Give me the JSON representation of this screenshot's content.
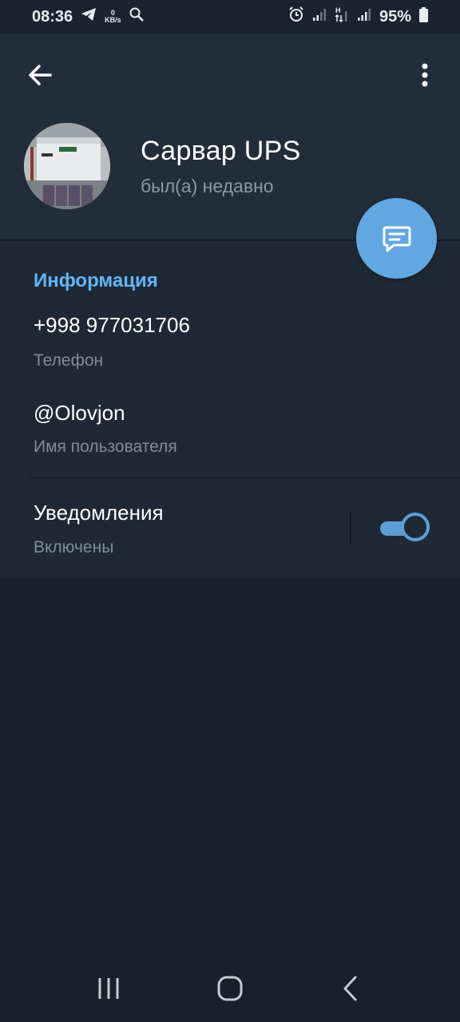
{
  "status_bar": {
    "time": "08:36",
    "net_speed_value": "0",
    "net_speed_unit": "KB/s",
    "network_type": "H",
    "battery": "95%",
    "icons": [
      "telegram-icon",
      "search-icon",
      "alarm-icon",
      "signal-icon",
      "signal-h-icon",
      "signal-icon",
      "battery-icon"
    ]
  },
  "header": {
    "back_icon": "arrow-left-icon",
    "more_icon": "more-vertical-icon",
    "name": "Сарвар UPS",
    "status": "был(а) недавно"
  },
  "fab": {
    "icon": "message-icon"
  },
  "info": {
    "title": "Информация",
    "phone": {
      "value": "+998 977031706",
      "label": "Телефон"
    },
    "username": {
      "value": "@Olovjon",
      "label": "Имя пользователя"
    },
    "notifications": {
      "value": "Уведомления",
      "label": "Включены",
      "enabled": true
    }
  },
  "nav": {
    "icons": [
      "recent-apps-icon",
      "home-icon",
      "back-icon"
    ]
  },
  "colors": {
    "accent": "#61a8e2",
    "section_title": "#64b5f6",
    "header_bg": "#222d3b",
    "section_bg": "#1f2936",
    "page_bg": "#18202b"
  }
}
